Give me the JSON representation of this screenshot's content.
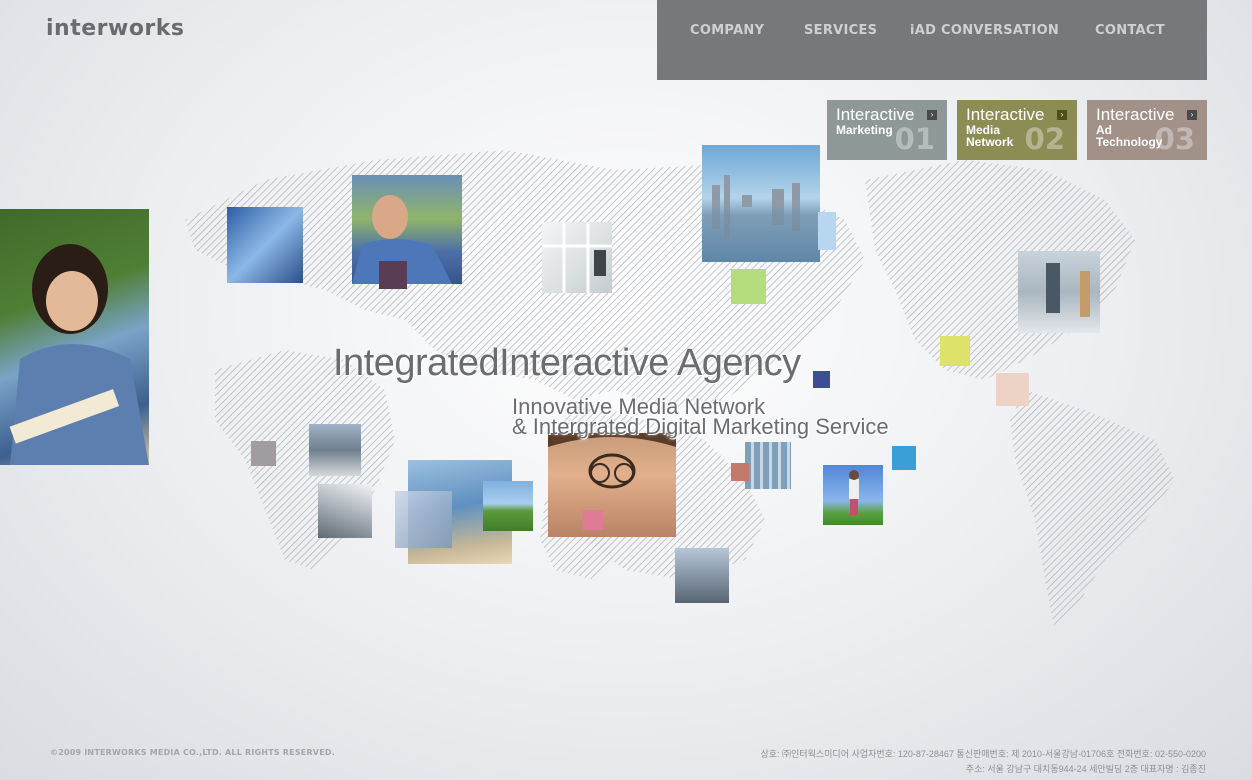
{
  "brand": {
    "logo": "interworks"
  },
  "nav": {
    "items": [
      {
        "label": "COMPANY"
      },
      {
        "label": "SERVICES"
      },
      {
        "label": "iAD CONVERSATION"
      },
      {
        "label": "CONTACT"
      }
    ]
  },
  "services": [
    {
      "title": "Interactive",
      "subtitle_lines": [
        "Marketing"
      ],
      "number": "01",
      "color": "#8e9899"
    },
    {
      "title": "Interactive",
      "subtitle_lines": [
        "Media",
        "Network"
      ],
      "number": "02",
      "color": "#8c8d55"
    },
    {
      "title": "Interactive",
      "subtitle_lines": [
        "Ad",
        "Technology"
      ],
      "number": "03",
      "color": "#a19189"
    }
  ],
  "hero": {
    "headline_part1": "Integrated",
    "headline_part2": "Interactive Agency",
    "sub_line1": "Innovative Media Network",
    "sub_line2": "& Intergrated Digital Marketing Service"
  },
  "footer": {
    "copyright": "©2009 INTERWORKS MEDIA CO.,LTD. ALL RIGHTS RESERVED.",
    "company_info_line1": "상호: ㈜인터웍스미디어   사업자번호: 120-87-28467   통신판매번호: 제 2010-서울강남-01706호   전화번호: 02-550-0200",
    "company_info_line2": "주소: 서울 강남구 대치동944-24 세안빌딩 2층   대표자명 : 김종진"
  },
  "colors": {
    "nav_bg": "#77787b",
    "accent_green": "#b6dd7d",
    "accent_yellow": "#dde36a",
    "accent_blue": "#3a9fd8",
    "accent_navy": "#3c4e96"
  }
}
